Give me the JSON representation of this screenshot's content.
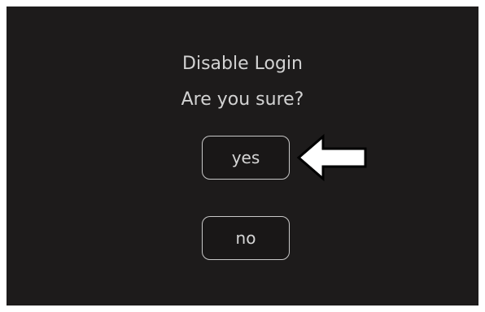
{
  "dialog": {
    "title": "Disable Login",
    "question": "Are you sure?",
    "yes_label": "yes",
    "no_label": "no"
  },
  "annotation": {
    "arrow_icon": "left-arrow-icon",
    "arrow_color": "#ffffff"
  },
  "colors": {
    "background": "#1d1b1b",
    "text": "#d2d2d2",
    "button_border": "#c8c8c8"
  }
}
